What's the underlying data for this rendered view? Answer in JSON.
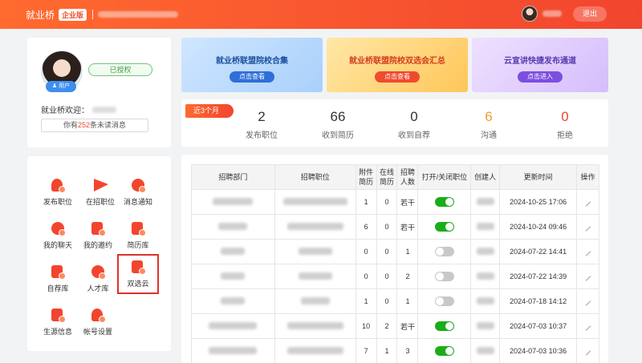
{
  "header": {
    "brand": "就业桥",
    "edition": "企业版",
    "logout_label": "退出"
  },
  "profile": {
    "user_tag": "用户",
    "auth_status": "已授权",
    "welcome": "就业桥欢迎：",
    "unread_prefix": "你有",
    "unread_count": "252",
    "unread_suffix": "条未读消息"
  },
  "quick_menu": [
    {
      "label": "发布职位",
      "icon": "post-job-icon"
    },
    {
      "label": "在招职位",
      "icon": "paper-plane-icon"
    },
    {
      "label": "消息通知",
      "icon": "message-icon"
    },
    {
      "label": "我的聊天",
      "icon": "chat-icon"
    },
    {
      "label": "我的邀约",
      "icon": "invitation-icon"
    },
    {
      "label": "简历库",
      "icon": "resume-icon"
    },
    {
      "label": "自荐库",
      "icon": "self-recommend-icon"
    },
    {
      "label": "人才库",
      "icon": "talent-cloud-icon"
    },
    {
      "label": "双选云",
      "icon": "hourglass-icon"
    },
    {
      "label": "生源信息",
      "icon": "student-source-icon"
    },
    {
      "label": "帐号设置",
      "icon": "account-settings-icon"
    }
  ],
  "banners": [
    {
      "title": "就业桥联盟院校合集",
      "button": "点击查看"
    },
    {
      "title": "就业桥联盟院校双选会汇总",
      "button": "点击查看"
    },
    {
      "title": "云宣讲快捷发布通道",
      "button": "点击进入"
    }
  ],
  "stats": {
    "period": "近3个月",
    "items": [
      {
        "value": "2",
        "label": "发布职位"
      },
      {
        "value": "66",
        "label": "收到简历"
      },
      {
        "value": "0",
        "label": "收到自荐"
      },
      {
        "value": "6",
        "label": "沟通"
      },
      {
        "value": "0",
        "label": "拒绝"
      }
    ]
  },
  "table": {
    "headers": [
      "招聘部门",
      "招聘职位",
      "附件简历",
      "在线简历",
      "招聘人数",
      "打开/关闭职位",
      "创建人",
      "更新时间",
      "操作"
    ],
    "rows": [
      {
        "attach": "1",
        "online": "0",
        "count": "若干",
        "open": true,
        "updated": "2024-10-25 17:06"
      },
      {
        "attach": "6",
        "online": "0",
        "count": "若干",
        "open": true,
        "updated": "2024-10-24 09:46"
      },
      {
        "attach": "0",
        "online": "0",
        "count": "1",
        "open": false,
        "updated": "2024-07-22 14:41"
      },
      {
        "attach": "0",
        "online": "0",
        "count": "2",
        "open": false,
        "updated": "2024-07-22 14:39"
      },
      {
        "attach": "1",
        "online": "0",
        "count": "1",
        "open": false,
        "updated": "2024-07-18 14:12"
      },
      {
        "attach": "10",
        "online": "2",
        "count": "若干",
        "open": true,
        "updated": "2024-07-03 10:37"
      },
      {
        "attach": "7",
        "online": "1",
        "count": "3",
        "open": true,
        "updated": "2024-07-03 10:36"
      }
    ]
  }
}
